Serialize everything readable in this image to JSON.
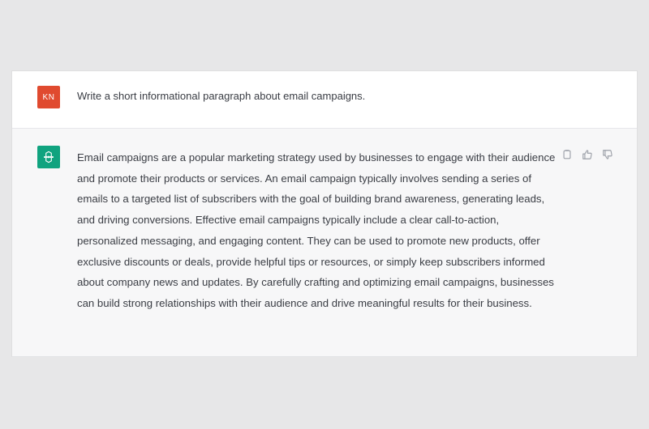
{
  "user": {
    "avatar_initials": "KN",
    "message": "Write a short informational paragraph about email campaigns."
  },
  "assistant": {
    "avatar_icon": "openai-logo-icon",
    "message": "Email campaigns are a popular marketing strategy used by businesses to engage with their audience and promote their products or services. An email campaign typically involves sending a series of emails to a targeted list of subscribers with the goal of building brand awareness, generating leads, and driving conversions. Effective email campaigns typically include a clear call-to-action, personalized messaging, and engaging content. They can be used to promote new products, offer exclusive discounts or deals, provide helpful tips or resources, or simply keep subscribers informed about company news and updates. By carefully crafting and optimizing email campaigns, businesses can build strong relationships with their audience and drive meaningful results for their business.",
    "actions": [
      "copy-icon",
      "thumbs-up-icon",
      "thumbs-down-icon"
    ]
  },
  "colors": {
    "background": "#e7e7e8",
    "user_avatar": "#e04a2f",
    "assistant_avatar": "#10a37f",
    "assistant_row": "#f7f7f8",
    "text": "#3a3d44"
  }
}
